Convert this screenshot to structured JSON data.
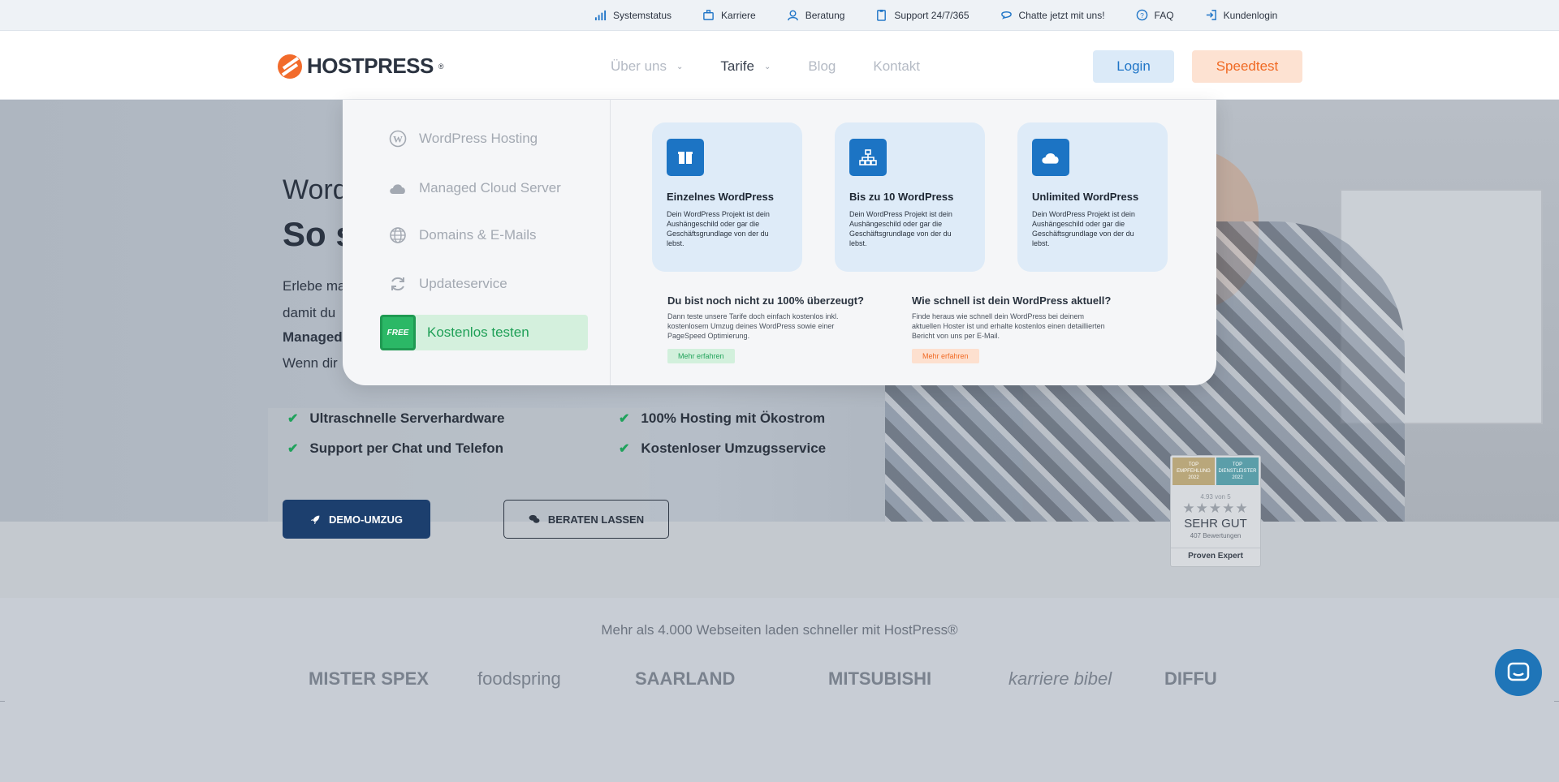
{
  "topbar": {
    "items": [
      {
        "label": "Systemstatus",
        "icon": "signal-bars-icon"
      },
      {
        "label": "Karriere",
        "icon": "briefcase-icon"
      },
      {
        "label": "Beratung",
        "icon": "user-headset-icon"
      },
      {
        "label": "Support 24/7/365",
        "icon": "clipboard-icon"
      },
      {
        "label": "Chatte jetzt mit uns!",
        "icon": "chat-bubble-icon"
      },
      {
        "label": "FAQ",
        "icon": "question-circle-icon"
      },
      {
        "label": "Kundenlogin",
        "icon": "sign-in-icon"
      }
    ]
  },
  "header": {
    "logo_text": "HOSTPRESS",
    "logo_reg": "®",
    "nav": [
      {
        "label": "Über uns",
        "has_dropdown": true,
        "active": false
      },
      {
        "label": "Tarife",
        "has_dropdown": true,
        "active": true
      },
      {
        "label": "Blog",
        "has_dropdown": false,
        "active": false
      },
      {
        "label": "Kontakt",
        "has_dropdown": false,
        "active": false
      }
    ],
    "login_label": "Login",
    "speedtest_label": "Speedtest"
  },
  "mega_menu": {
    "items": [
      {
        "label": "WordPress Hosting",
        "icon": "wordpress-icon"
      },
      {
        "label": "Managed Cloud Server",
        "icon": "cloud-icon"
      },
      {
        "label": "Domains & E-Mails",
        "icon": "globe-icon"
      },
      {
        "label": "Updateservice",
        "icon": "refresh-icon"
      },
      {
        "label": "Kostenlos testen",
        "icon": "free-badge-icon",
        "badge": "FREE"
      }
    ],
    "plans": [
      {
        "title": "Einzelnes WordPress",
        "desc": "Dein WordPress Projekt ist dein  Aushängeschild oder gar die Geschäftsgrundlage von der du lebst.",
        "icon": "box-icon"
      },
      {
        "title": "Bis zu 10 WordPress",
        "desc": "Dein WordPress Projekt ist dein  Aushängeschild oder gar die Geschäftsgrundlage von der du lebst.",
        "icon": "network-icon"
      },
      {
        "title": "Unlimited WordPress",
        "desc": "Dein WordPress Projekt ist dein  Aushängeschild oder gar die Geschäftsgrundlage von der du lebst.",
        "icon": "cloud-icon"
      }
    ],
    "promos": [
      {
        "title": "Du bist noch nicht zu 100% überzeugt?",
        "desc": "Dann teste unsere Tarife doch einfach kostenlos inkl. kostenlosem Umzug deines WordPress sowie einer PageSpeed Optimierung.",
        "button": "Mehr erfahren"
      },
      {
        "title": "Wie schnell ist dein WordPress aktuell?",
        "desc": "Finde heraus wie schnell dein WordPress bei deinem aktuellen Hoster ist und erhalte kostenlos einen detaillierten Bericht von uns per E-Mail.",
        "button": "Mehr erfahren"
      }
    ]
  },
  "hero": {
    "title_small": "Word",
    "title_big": "So s",
    "lines": [
      "Erlebe ma",
      "damit du",
      "Managed",
      "Wenn dir"
    ],
    "features": [
      "Ultraschnelle Serverhardware",
      "100% Hosting mit Ökostrom",
      "Support per Chat und Telefon",
      "Kostenloser Umzugsservice"
    ],
    "demo_button": "DEMO-UMZUG",
    "beraten_button": "BERATEN LASSEN"
  },
  "proven_expert": {
    "seal_left": "TOP EMPFEHLUNG 2022",
    "seal_right": "TOP DIENSTLEISTER 2022",
    "score": "4.93 von 5",
    "stars": "★★★★★",
    "rating": "SEHR GUT",
    "count": "407 Bewertungen",
    "brand": "Proven Expert"
  },
  "clients": {
    "title": "Mehr als 4.000 Webseiten laden schneller mit HostPress®",
    "logos": [
      "MISTER SPEX",
      "foodspring",
      "SAARLAND",
      "MITSUBISHI",
      "karriere bibel",
      "DIFFU"
    ]
  }
}
